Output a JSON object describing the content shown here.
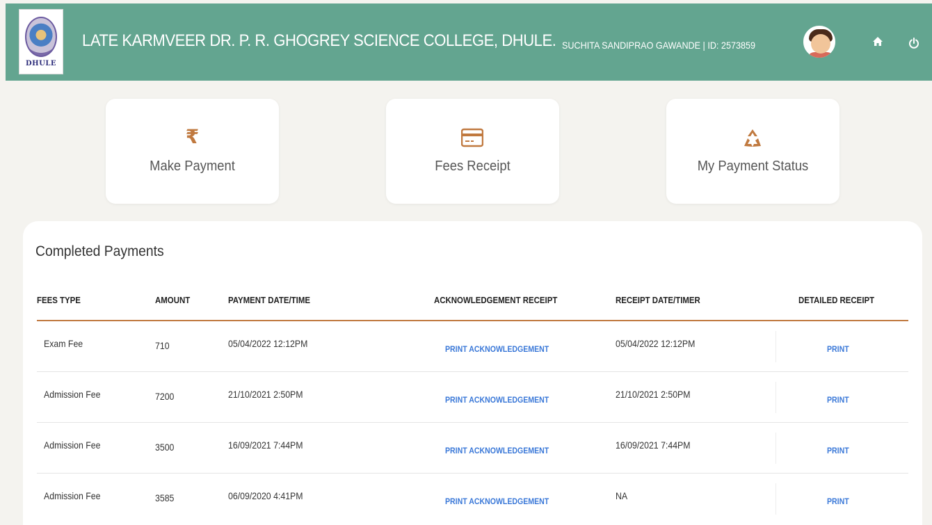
{
  "header": {
    "logo_text": "DHULE",
    "college_name": "LATE KARMVEER DR. P. R. GHOGREY SCIENCE COLLEGE, DHULE.",
    "user_info": "SUCHITA SANDIPRAO GAWANDE | ID: 2573859",
    "home_icon": "home-icon",
    "power_icon": "power-icon",
    "brand_color": "#63a590"
  },
  "cards": [
    {
      "label": "Make Payment",
      "icon": "rupee-icon"
    },
    {
      "label": "Fees Receipt",
      "icon": "credit-card-icon"
    },
    {
      "label": "My Payment Status",
      "icon": "recycle-icon"
    }
  ],
  "panel": {
    "title": "Completed Payments",
    "columns": [
      "FEES TYPE",
      "AMOUNT",
      "PAYMENT DATE/TIME",
      "ACKNOWLEDGEMENT RECEIPT",
      "RECEIPT DATE/TIMER",
      "DETAILED RECEIPT"
    ],
    "rows": [
      {
        "fees_type": "Exam Fee",
        "amount": "710",
        "payment_datetime": "05/04/2022 12:12PM",
        "ack": "PRINT ACKNOWLEDGEMENT",
        "receipt_datetime": "05/04/2022 12:12PM",
        "detailed": "PRINT"
      },
      {
        "fees_type": "Admission Fee",
        "amount": "7200",
        "payment_datetime": "21/10/2021 2:50PM",
        "ack": "PRINT ACKNOWLEDGEMENT",
        "receipt_datetime": "21/10/2021 2:50PM",
        "detailed": "PRINT"
      },
      {
        "fees_type": "Admission Fee",
        "amount": "3500",
        "payment_datetime": "16/09/2021 7:44PM",
        "ack": "PRINT ACKNOWLEDGEMENT",
        "receipt_datetime": "16/09/2021 7:44PM",
        "detailed": "PRINT"
      },
      {
        "fees_type": "Admission Fee",
        "amount": "3585",
        "payment_datetime": "06/09/2020 4:41PM",
        "ack": "PRINT ACKNOWLEDGEMENT",
        "receipt_datetime": "NA",
        "detailed": "PRINT"
      }
    ]
  },
  "colors": {
    "accent": "#c0793f",
    "link": "#3a78d8",
    "background": "#f4f3ef"
  }
}
